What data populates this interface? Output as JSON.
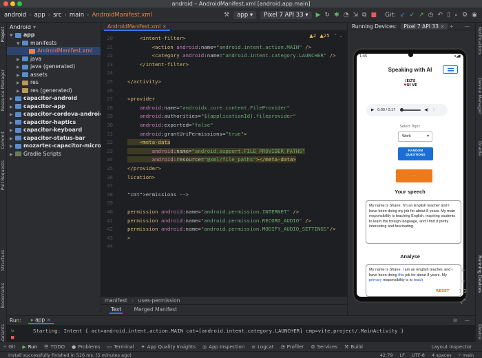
{
  "window": {
    "title": "android – AndroidManifest.xml [android.app.main]"
  },
  "navbar": {
    "breadcrumbs": [
      "android",
      "app",
      "src",
      "main",
      "AndroidManifest.xml"
    ],
    "run_config": "app",
    "device": "Pixel 7 API 33",
    "git_label": "Git:"
  },
  "project_panel": {
    "view_mode": "Android",
    "items": [
      {
        "label": "app",
        "level": 0,
        "kind": "folder",
        "bold": true
      },
      {
        "label": "manifests",
        "level": 1,
        "kind": "folder"
      },
      {
        "label": "AndroidManifest.xml",
        "level": 2,
        "kind": "xml",
        "selected": true
      },
      {
        "label": "java",
        "level": 1,
        "kind": "folder"
      },
      {
        "label": "java (generated)",
        "level": 1,
        "kind": "folder",
        "dim_suffix": true
      },
      {
        "label": "assets",
        "level": 1,
        "kind": "folder"
      },
      {
        "label": "res",
        "level": 1,
        "kind": "folder"
      },
      {
        "label": "res (generated)",
        "level": 1,
        "kind": "folder",
        "dim_suffix": true
      },
      {
        "label": "capacitor-android",
        "level": 0,
        "kind": "folder",
        "bold": true
      },
      {
        "label": "capacitor-app",
        "level": 0,
        "kind": "folder",
        "bold": true
      },
      {
        "label": "capacitor-cordova-android-plu",
        "level": 0,
        "kind": "folder",
        "bold": true
      },
      {
        "label": "capacitor-haptics",
        "level": 0,
        "kind": "folder",
        "bold": true
      },
      {
        "label": "capacitor-keyboard",
        "level": 0,
        "kind": "folder",
        "bold": true
      },
      {
        "label": "capacitor-status-bar",
        "level": 0,
        "kind": "folder",
        "bold": true
      },
      {
        "label": "mozartec-capacitor-microphon",
        "level": 0,
        "kind": "folder",
        "bold": true
      },
      {
        "label": "Gradle Scripts",
        "level": 0,
        "kind": "gradle"
      }
    ]
  },
  "left_strip": {
    "labels": [
      "Project",
      "Resource Manager",
      "Commit",
      "Pull Requests",
      "Structure",
      "Bookmarks",
      "Build Variants"
    ]
  },
  "right_strip": {
    "labels": [
      "Notifications",
      "Device Manager",
      "Gradle",
      "Running Devices",
      "Device Explorer"
    ]
  },
  "editor": {
    "file_tab": "AndroidManifest.xml",
    "warnings": "2",
    "errors": "25",
    "lines": [
      {
        "n": "20",
        "code": "    <intent-filter>"
      },
      {
        "n": "21",
        "code": "        <action android:name=\"android.intent.action.MAIN\" />"
      },
      {
        "n": "22",
        "code": "        <category android:name=\"android.intent.category.LAUNCHER\" />"
      },
      {
        "n": "23",
        "code": "    </intent-filter>"
      },
      {
        "n": "24",
        "code": ""
      },
      {
        "n": "25",
        "code": "</activity>"
      },
      {
        "n": "26",
        "code": ""
      },
      {
        "n": "27",
        "code": "<provider"
      },
      {
        "n": "28",
        "code": "    android:name=\"androidx.core.content.FileProvider\""
      },
      {
        "n": "29",
        "code": "    android:authorities=\"${applicationId}.fileprovider\""
      },
      {
        "n": "30",
        "code": "    android:exported=\"false\""
      },
      {
        "n": "31",
        "code": "    android:grantUriPermissions=\"true\">"
      },
      {
        "n": "32",
        "code": "    <meta-data"
      },
      {
        "n": "33",
        "code": "        android:name=\"android.support.FILE_PROVIDER_PATHS\""
      },
      {
        "n": "34",
        "code": "        android:resource=\"@xml/file_paths\"></meta-data>"
      },
      {
        "n": "35",
        "code": "</provider>"
      },
      {
        "n": "36",
        "code": "lication>"
      },
      {
        "n": "37",
        "code": ""
      },
      {
        "n": "38",
        "code": "ermissions -->"
      },
      {
        "n": "39",
        "code": ""
      },
      {
        "n": "40",
        "code": "permission android:name=\"android.permission.INTERNET\" />"
      },
      {
        "n": "41",
        "code": "permission android:name=\"android.permission.RECORD_AUDIO\" />"
      },
      {
        "n": "42",
        "code": "permission android:name=\"android.permission.MODIFY_AUDIO_SETTINGS\"/>"
      },
      {
        "n": "43",
        "code": ">"
      },
      {
        "n": "44",
        "code": ""
      }
    ],
    "footer_breadcrumb": [
      "manifest",
      "uses-permission"
    ],
    "bottom_tabs": [
      "Text",
      "Merged Manifest"
    ]
  },
  "running_devices": {
    "panel_title": "Running Devices:",
    "device_tab": "Pixel 7 API 33"
  },
  "phone_app": {
    "status_time": "1:45",
    "title": "Speaking with AI",
    "logo_text": "IELTS",
    "logo_sub": "UI VÉ",
    "audio_time": "0:00 / 0:17",
    "topic_label": "Select Topic",
    "topic_value": "Work",
    "random_button": "RANDOM QUESTIONS",
    "record_button": "-",
    "speech_heading": "Your speech",
    "speech_text": "My name is Shane. I'm an English teacher and I have been doing my job for about 8 years. My main responsibility is teaching English, inspiring students to learn the foreign language, and I find it pretty interesting and fascinating.",
    "analyse_heading": "Analyse",
    "analyse_text_parts": [
      {
        "t": "My name is Shane. ",
        "hl": false
      },
      {
        "t": "I",
        "hl": true
      },
      {
        "t": " am",
        "hl": false
      },
      {
        "t": " an English teacher, and I have been doing ",
        "hl": false
      },
      {
        "t": "this",
        "hl": true
      },
      {
        "t": " job for about 8 years. My ",
        "hl": false
      },
      {
        "t": "primary",
        "hl": true
      },
      {
        "t": " responsibility is to ",
        "hl": false
      },
      {
        "t": "teach",
        "hl": true
      }
    ],
    "reset_button": "RESET"
  },
  "emulator_zoom": "1:1",
  "run_panel": {
    "label": "Run:",
    "tab": "app",
    "console_line": "Starting: Intent { act=android.intent.action.MAIN cat=[android.intent.category.LAUNCHER] cmp=vite.project/.MainActivity }"
  },
  "bottom_toolbar": {
    "items": [
      "Git",
      "Run",
      "TODO",
      "Problems",
      "Terminal",
      "App Quality Insights",
      "App Inspection",
      "Logcat",
      "Profiler",
      "Services",
      "Build"
    ],
    "right": "Layout Inspector"
  },
  "status_bar": {
    "message": "Install successfully finished in 516 ms. (5 minutes ago)",
    "cursor": "42:79",
    "line_sep": "LF",
    "encoding": "UTF-8",
    "indent": "4 spaces",
    "branch": "main"
  }
}
